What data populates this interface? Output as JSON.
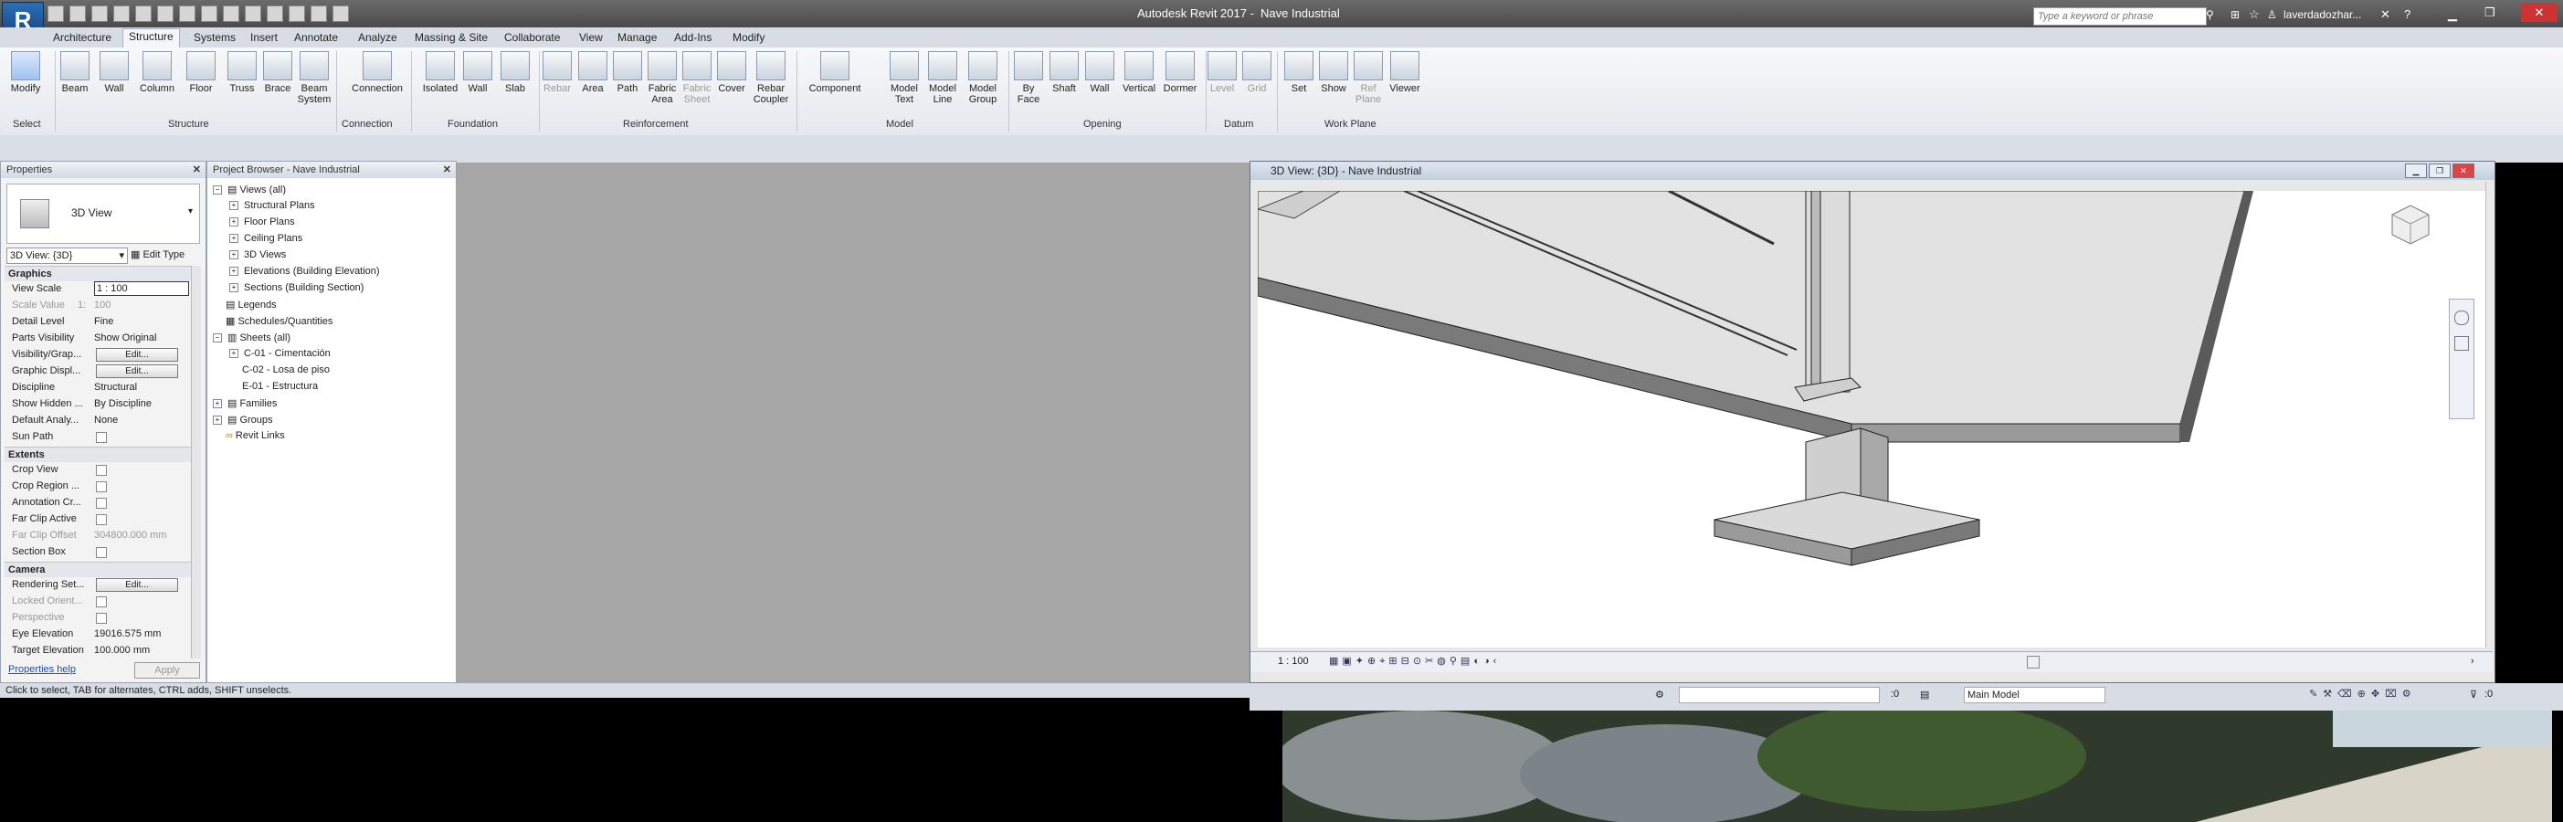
{
  "app": {
    "title": "Autodesk Revit 2017 -",
    "document": "Nave Industrial",
    "r_label": "R"
  },
  "search": {
    "placeholder": "Type a keyword or phrase"
  },
  "user": {
    "name": "laverdadozhar..."
  },
  "tabs": [
    "Architecture",
    "Structure",
    "Systems",
    "Insert",
    "Annotate",
    "Analyze",
    "Massing & Site",
    "Collaborate",
    "View",
    "Manage",
    "Add-Ins",
    "Modify"
  ],
  "ribbon": {
    "buttons": [
      {
        "label": "Modify"
      },
      {
        "label": "Beam"
      },
      {
        "label": "Wall"
      },
      {
        "label": "Column"
      },
      {
        "label": "Floor"
      },
      {
        "label": "Truss"
      },
      {
        "label": "Brace"
      },
      {
        "label": "Beam\nSystem"
      },
      {
        "label": "Connection"
      },
      {
        "label": "Isolated"
      },
      {
        "label": "Wall"
      },
      {
        "label": "Slab"
      },
      {
        "label": "Rebar"
      },
      {
        "label": "Area"
      },
      {
        "label": "Path"
      },
      {
        "label": "Fabric\nArea"
      },
      {
        "label": "Fabric\nSheet"
      },
      {
        "label": "Cover"
      },
      {
        "label": "Rebar\nCoupler"
      },
      {
        "label": "Component"
      },
      {
        "label": "Model\nText"
      },
      {
        "label": "Model\nLine"
      },
      {
        "label": "Model\nGroup"
      },
      {
        "label": "By\nFace"
      },
      {
        "label": "Shaft"
      },
      {
        "label": "Wall"
      },
      {
        "label": "Vertical"
      },
      {
        "label": "Dormer"
      },
      {
        "label": "Level"
      },
      {
        "label": "Grid"
      },
      {
        "label": "Set"
      },
      {
        "label": "Show"
      },
      {
        "label": "Ref\nPlane"
      },
      {
        "label": "Viewer"
      }
    ],
    "panels": [
      "Select",
      "Structure",
      "Connection",
      "Foundation",
      "Reinforcement",
      "Model",
      "Opening",
      "Datum",
      "Work Plane"
    ]
  },
  "properties": {
    "header": "Properties",
    "type_label": "3D View",
    "instance_select": "3D View: {3D}",
    "edit_type": "Edit Type",
    "sections": {
      "graphics": "Graphics",
      "extents": "Extents",
      "camera": "Camera"
    },
    "rows": {
      "view_scale": {
        "k": "View Scale",
        "v": "1 : 100"
      },
      "scale_value": {
        "k": "Scale Value",
        "v1": "1:",
        "v": "100"
      },
      "detail_level": {
        "k": "Detail Level",
        "v": "Fine"
      },
      "parts_visibility": {
        "k": "Parts Visibility",
        "v": "Show Original"
      },
      "visibility_graphics": {
        "k": "Visibility/Grap...",
        "v": "Edit..."
      },
      "graphic_display": {
        "k": "Graphic Displ...",
        "v": "Edit..."
      },
      "discipline": {
        "k": "Discipline",
        "v": "Structural"
      },
      "show_hidden": {
        "k": "Show Hidden ...",
        "v": "By Discipline"
      },
      "default_analysis": {
        "k": "Default Analy...",
        "v": "None"
      },
      "sun_path": {
        "k": "Sun Path"
      },
      "crop_view": {
        "k": "Crop View"
      },
      "crop_region": {
        "k": "Crop Region ..."
      },
      "annotation_crop": {
        "k": "Annotation Cr..."
      },
      "far_clip_active": {
        "k": "Far Clip Active"
      },
      "far_clip_offset": {
        "k": "Far Clip Offset",
        "v": "304800.000 mm"
      },
      "section_box": {
        "k": "Section Box"
      },
      "rendering_settings": {
        "k": "Rendering Set...",
        "v": "Edit..."
      },
      "locked_orientation": {
        "k": "Locked Orient..."
      },
      "perspective": {
        "k": "Perspective"
      },
      "eye_elevation": {
        "k": "Eye Elevation",
        "v": "19016.575 mm"
      },
      "target_elevation": {
        "k": "Target Elevation",
        "v": "100.000 mm"
      }
    },
    "help": "Properties help",
    "apply": "Apply"
  },
  "browser": {
    "header": "Project Browser - Nave Industrial",
    "items": {
      "views": "Views (all)",
      "structural_plans": "Structural Plans",
      "floor_plans": "Floor Plans",
      "ceiling_plans": "Ceiling Plans",
      "views3d": "3D Views",
      "elevations": "Elevations (Building Elevation)",
      "sections": "Sections (Building Section)",
      "legends": "Legends",
      "schedules": "Schedules/Quantities",
      "sheets": "Sheets (all)",
      "sheet1": "C-01 - Cimentación",
      "sheet2": "C-02 - Losa de piso",
      "sheet3": "E-01 - Estructura",
      "families": "Families",
      "groups": "Groups",
      "revit_links": "Revit Links"
    }
  },
  "view3d": {
    "title": "3D View: {3D} - Nave Industrial",
    "scale": "1 : 100"
  },
  "status": {
    "hint": "Click to select, TAB for alternates, CTRL adds, SHIFT unselects.",
    "workset_count": ":0",
    "model": "Main Model",
    "filter_count": ":0"
  }
}
